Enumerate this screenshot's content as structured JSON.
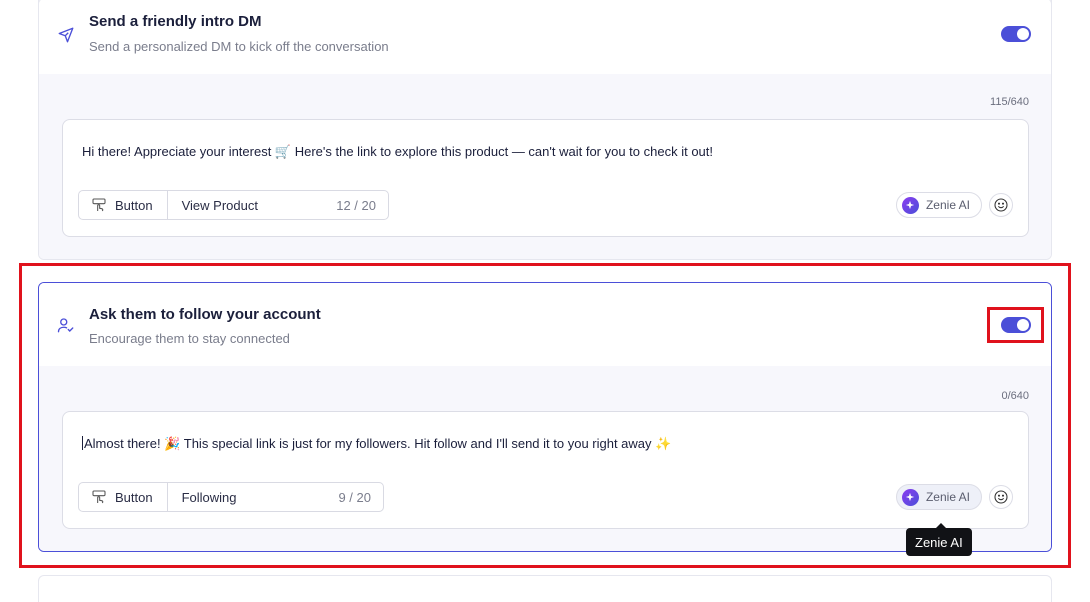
{
  "steps": [
    {
      "title": "Send a friendly intro DM",
      "subtitle": "Send a personalized DM to kick off the conversation",
      "counter": "115/640",
      "message": "Hi there! Appreciate your interest 🛒 Here's the link to explore this product — can't wait for you to check it out!",
      "button_type": "Button",
      "button_label": "View Product",
      "button_count": "12 / 20",
      "ai_label": "Zenie AI",
      "enabled": true
    },
    {
      "title": "Ask them to follow your account",
      "subtitle": "Encourage them to stay connected",
      "counter": "0/640",
      "message": "Almost there! 🎉 This special link is just for my followers. Hit follow and I'll send it to you right away ✨",
      "button_type": "Button",
      "button_label": "Following",
      "button_count": "9 / 20",
      "ai_label": "Zenie AI",
      "enabled": true
    }
  ],
  "tooltip": "Zenie AI",
  "colors": {
    "accent": "#4b4fd8",
    "highlight": "#e0121c"
  },
  "icons": [
    "send-icon",
    "user-check-icon",
    "hand-pointer-icon",
    "sparkle-icon",
    "smiley-icon"
  ]
}
